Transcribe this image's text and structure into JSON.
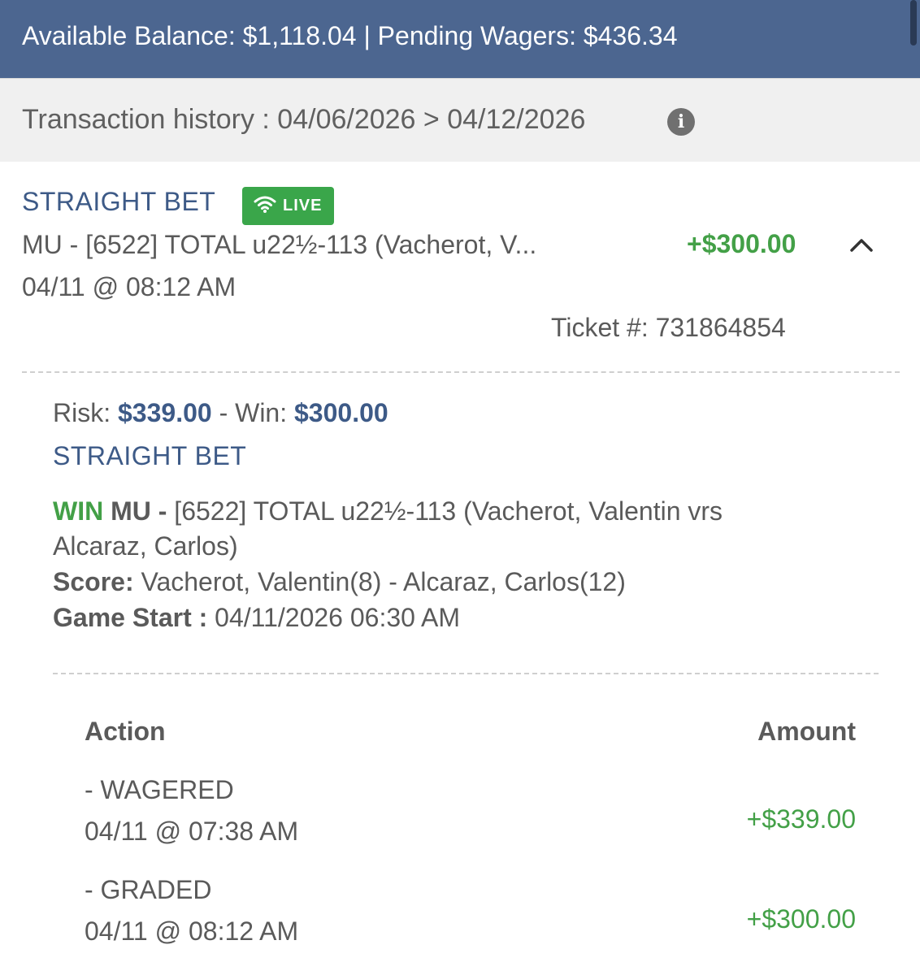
{
  "header": {
    "balance_text": "Available Balance: $1,118.04 | Pending Wagers: $436.34"
  },
  "subheader": {
    "history_text": "Transaction history : 04/06/2026 > 04/12/2026",
    "info_icon": "info-icon"
  },
  "bet": {
    "type": "STRAIGHT BET",
    "live_label": "LIVE",
    "description_short": "MU - [6522] TOTAL u22½-113 (Vacherot, V...",
    "amount": "+$300.00",
    "date": "04/11 @ 08:12 AM",
    "ticket": "Ticket #: 731864854",
    "expand_icon": "chevron-up-icon"
  },
  "details": {
    "risk_label": "Risk:",
    "risk_value": "$339.00",
    "win_sep": "- Win:",
    "win_value": "$300.00",
    "type": "STRAIGHT BET",
    "result": "WIN",
    "market": "MU -",
    "selection_line1": "[6522] TOTAL u22½-113 (Vacherot, Valentin vrs",
    "selection_line2": "Alcaraz, Carlos)",
    "score_label": "Score:",
    "score_value": "Vacherot, Valentin(8) - Alcaraz, Carlos(12)",
    "game_start_label": "Game Start :",
    "game_start_value": "04/11/2026 06:30 AM"
  },
  "actions": {
    "headers": {
      "action": "Action",
      "amount": "Amount"
    },
    "rows": [
      {
        "action": "- WAGERED",
        "date": "04/11 @ 07:38 AM",
        "amount": "+$339.00"
      },
      {
        "action": "- GRADED",
        "date": "04/11 @ 08:12 AM",
        "amount": "+$300.00"
      }
    ]
  },
  "colors": {
    "header_bg": "#4c6690",
    "accent_navy": "#3d5a87",
    "win_green": "#43a047",
    "live_badge": "#3aa64a"
  }
}
